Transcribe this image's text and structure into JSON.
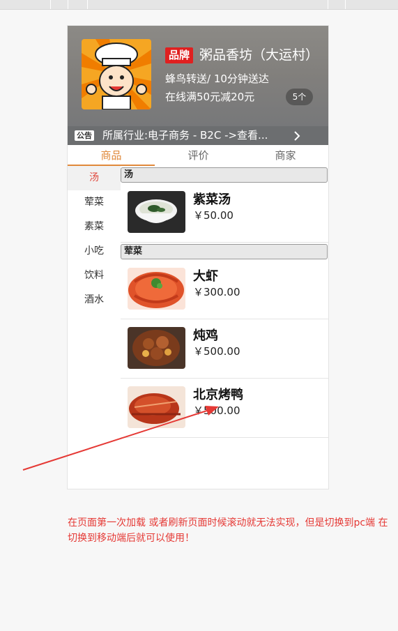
{
  "header": {
    "brand_badge": "品牌",
    "shop_name": "粥品香坊（大运村）",
    "delivery": "蜂鸟转送/ 10分钟送达",
    "promo": "在线满50元减20元",
    "promo_count": "5个"
  },
  "notice": {
    "tag": "公告",
    "text": "所属行业:电子商务 - B2C ->查看..."
  },
  "tabs": [
    {
      "label": "商品"
    },
    {
      "label": "评价"
    },
    {
      "label": "商家"
    }
  ],
  "sidebar": {
    "items": [
      {
        "label": "汤"
      },
      {
        "label": "荤菜"
      },
      {
        "label": "素菜"
      },
      {
        "label": "小吃"
      },
      {
        "label": "饮料"
      },
      {
        "label": "酒水"
      }
    ]
  },
  "sections": [
    {
      "title": "汤",
      "items": [
        {
          "name": "紫菜汤",
          "price": "￥50.00"
        }
      ]
    },
    {
      "title": "荤菜",
      "items": [
        {
          "name": "大虾",
          "price": "￥300.00"
        },
        {
          "name": "炖鸡",
          "price": "￥500.00"
        },
        {
          "name": "北京烤鸭",
          "price": "￥500.00"
        }
      ]
    }
  ],
  "note": "在页面第一次加载 或者刷新页面时候滚动就无法实现，但是切换到pc端 在切换到移动端后就可以使用！",
  "colors": {
    "accent": "#e0893a",
    "active_side": "#e0453a",
    "note_red": "#e53935",
    "badge_red": "#e02020"
  }
}
